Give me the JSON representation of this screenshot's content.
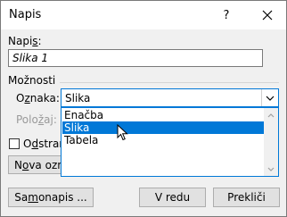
{
  "window": {
    "title": "Napis",
    "help_label": "?",
    "close_icon": "close-icon"
  },
  "caption": {
    "label_prefix": "Napi",
    "label_mnemonic": "s",
    "label_suffix": ":",
    "value": "Slika 1"
  },
  "options": {
    "section_label": "Možnosti",
    "label_type_prefix": "O",
    "label_type_mnemonic": "z",
    "label_type_suffix": "naka:",
    "selected_type": "Slika",
    "type_options": [
      "Enačba",
      "Slika",
      "Tabela"
    ],
    "highlighted_index": 1,
    "position_label_prefix": "Polo",
    "position_label_mnemonic": "ž",
    "position_label_suffix": "aj:",
    "exclude_label_prefix": "O",
    "exclude_label_mnemonic": "d",
    "exclude_label_suffix": "stran",
    "exclude_checked": false
  },
  "buttons": {
    "new_label_prefix": "N",
    "new_label_mnemonic": "o",
    "new_label_suffix": "va ozna",
    "autocaption_prefix": "Sa",
    "autocaption_mnemonic": "m",
    "autocaption_suffix": "onapis ...",
    "ok": "V redu",
    "cancel": "Prekliči"
  }
}
